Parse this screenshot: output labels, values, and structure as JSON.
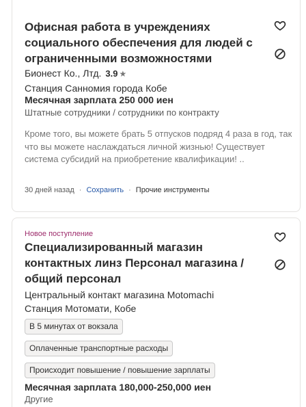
{
  "jobs": [
    {
      "title": "Офисная работа в учреждениях социального обеспечения для людей с ограниченными возможностями",
      "company": "Бионест Ко., Лтд.",
      "rating": "3.9",
      "rating_star": "★",
      "location": "Станция Санномия города Кобе",
      "salary": "Месячная зарплата 250 000 иен",
      "employment": "Штатные сотрудники / сотрудники по контракту",
      "snippet": "Кроме того, вы можете брать 5 отпусков подряд 4 раза в год, так что вы можете наслаждаться личной жизнью! Существует система субсидий на приобретение квалификации! ..",
      "posted": "30 дней назад",
      "save_label": "Сохранить",
      "tools_label": "Прочие инструменты",
      "bullet": "·",
      "icons": [
        "heart-outline-icon",
        "not-interested-icon"
      ]
    },
    {
      "new_label": "Новое поступление",
      "title": "Специализированный магазин контактных линз Персонал магазина / общий персонал",
      "company_location_line1": "Центральный контакт магазина Motomachi",
      "company_location_line2": "Станция Мотомати, Кобе",
      "tags": [
        "В 5 минутах от вокзала",
        "Оплаченные транспортные расходы",
        "Происходит повышение / повышение зарплаты"
      ],
      "salary": "Месячная зарплата 180,000-250,000 иен",
      "employment": "Другие",
      "icons": [
        "heart-outline-icon",
        "not-interested-icon"
      ]
    }
  ],
  "colors": {
    "link": "#2557a7",
    "new_label": "#9d2b6b",
    "border": "#e4e2e0",
    "tag_bg": "#f3f2f1"
  }
}
